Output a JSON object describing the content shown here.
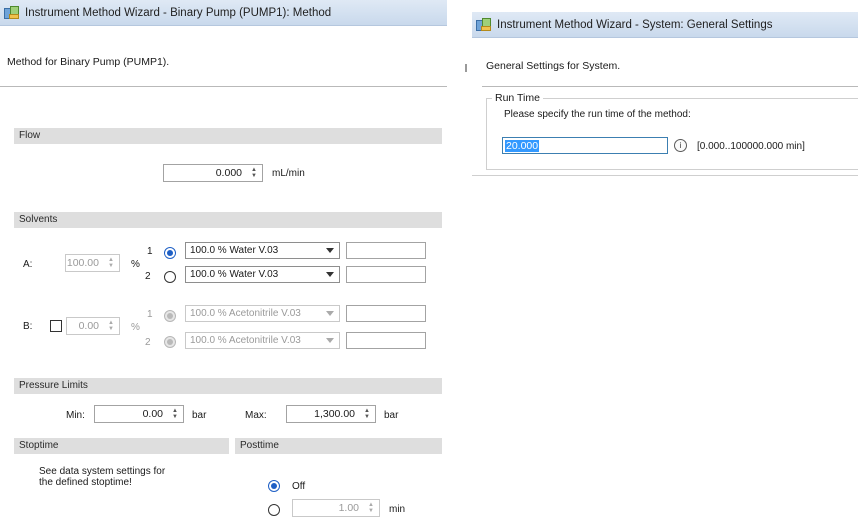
{
  "left_window": {
    "title": "Instrument Method Wizard - Binary Pump (PUMP1): Method",
    "description": "Method for Binary Pump (PUMP1).",
    "flow": {
      "section": "Flow",
      "value": "0.000",
      "unit": "mL/min"
    },
    "solvents": {
      "section": "Solvents",
      "a_label": "A:",
      "a_percent": "100.00",
      "a_percent_unit": "%",
      "a_rows": [
        {
          "channel": "1",
          "selected": true,
          "solvent": "100.0 % Water V.03"
        },
        {
          "channel": "2",
          "selected": false,
          "solvent": "100.0 % Water V.03"
        }
      ],
      "b_label": "B:",
      "b_percent": "0.00",
      "b_percent_unit": "%",
      "b_enabled": false,
      "b_rows": [
        {
          "channel": "1",
          "selected": true,
          "solvent": "100.0 % Acetonitrile V.03"
        },
        {
          "channel": "2",
          "selected": false,
          "solvent": "100.0 % Acetonitrile V.03"
        }
      ]
    },
    "pressure_limits": {
      "section": "Pressure Limits",
      "min_label": "Min:",
      "min_value": "0.00",
      "max_label": "Max:",
      "max_value": "1,300.00",
      "unit": "bar"
    },
    "stoptime": {
      "section": "Stoptime",
      "note_line1": "See data system settings for",
      "note_line2": "the defined stoptime!"
    },
    "posttime": {
      "section": "Posttime",
      "off_label": "Off",
      "off_selected": true,
      "value": "1.00",
      "unit": "min"
    }
  },
  "right_window": {
    "title": "Instrument Method Wizard - System: General Settings",
    "description": "General Settings for System.",
    "run_time": {
      "legend": "Run Time",
      "prompt": "Please specify the run time of the method:",
      "value": "20.000",
      "range": "[0.000..100000.000 min]"
    }
  },
  "icons": {
    "app": "wizard-app-icon",
    "spin": "spin-updown-icon",
    "dropdown": "chevron-down-icon",
    "info": "info-icon"
  },
  "colors": {
    "titlebar": "#dfe9f5",
    "section_bar": "#dedede",
    "selection": "#3399ff",
    "radio_selected": "#1e5fc5"
  }
}
